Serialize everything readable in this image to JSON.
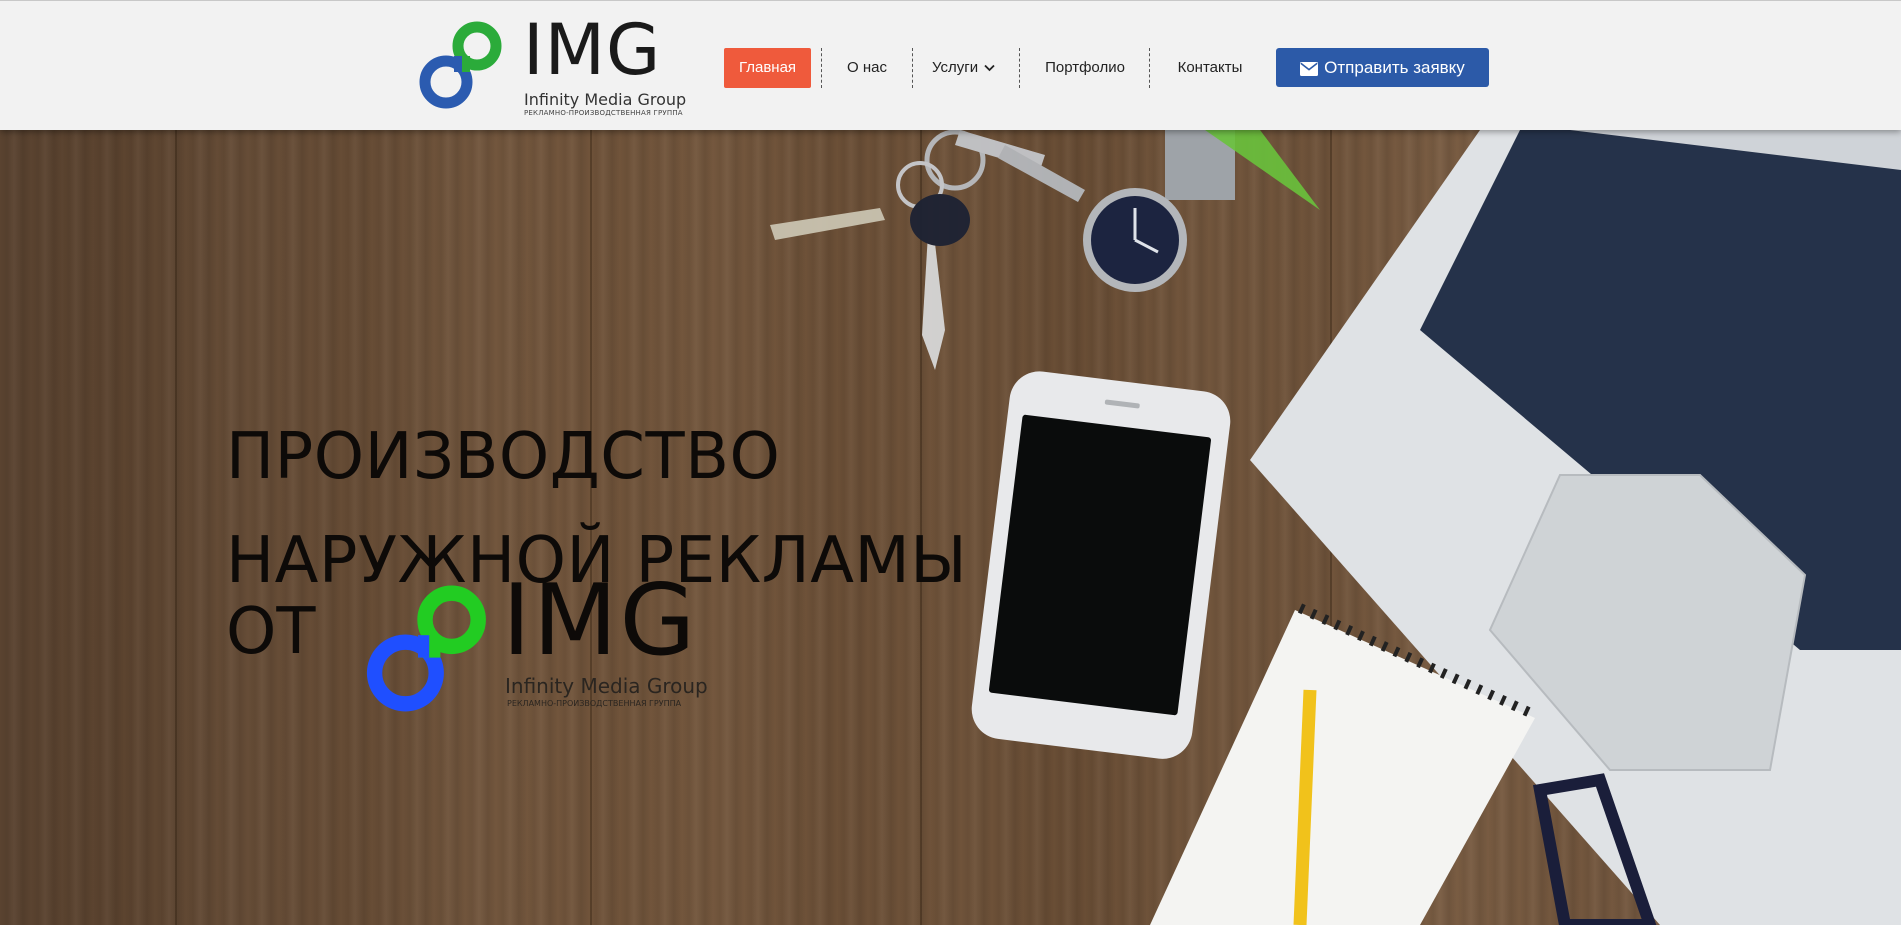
{
  "brand": {
    "word": "IMG",
    "name": "Infinity Media Group",
    "tagline": "РЕКЛАМНО-ПРОИЗВОДСТВЕННАЯ ГРУППА",
    "green": "#2bab3a",
    "blue": "#2b5bb0"
  },
  "nav": {
    "items": [
      {
        "label": "Главная",
        "active": true
      },
      {
        "label": "О нас"
      },
      {
        "label": "Услуги",
        "has_dropdown": true
      },
      {
        "label": "Портфолио"
      },
      {
        "label": "Контакты"
      }
    ],
    "cta_label": "Отправить заявку",
    "cta_icon": "envelope-icon",
    "active_color": "#ef5a3c",
    "cta_color": "#2c5aa8"
  },
  "hero": {
    "title_line1": "ПРОИЗВОДСТВО",
    "title_line2": "НАРУЖНОЙ РЕКЛАМЫ",
    "from_word": "ОТ",
    "logo": {
      "word": "IMG",
      "name": "Infinity Media Group",
      "tagline": "РЕКЛАМНО-ПРОИЗВОДСТВЕННАЯ ГРУППА",
      "green": "#22cc22",
      "blue": "#1f4fff"
    }
  }
}
